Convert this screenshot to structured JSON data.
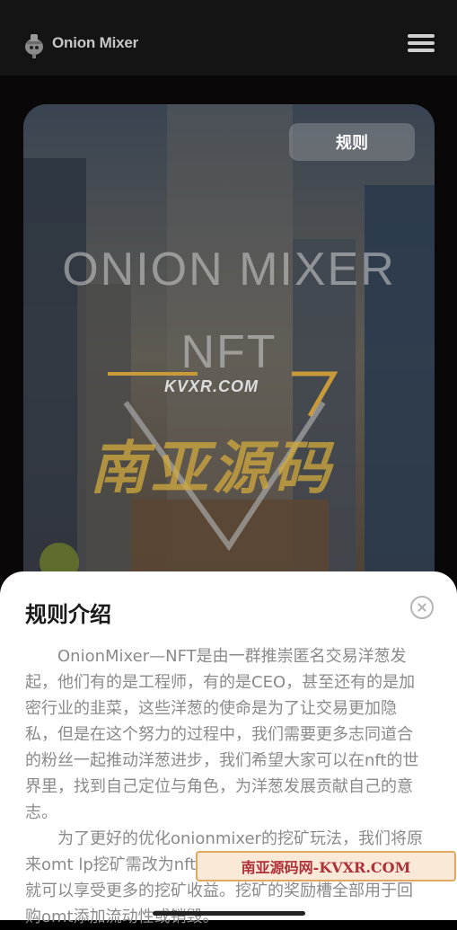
{
  "header": {
    "brand": "Onion Mixer",
    "logo_icon": "onion-logo-icon",
    "menu_icon": "hamburger-menu-icon"
  },
  "hero": {
    "rules_button": "规则",
    "title_line1": "ONION MIXER",
    "title_line2": "NFT",
    "watermark_small": "KVXR.COM",
    "watermark_big": "南亚源码"
  },
  "sheet": {
    "title": "规则介绍",
    "close_icon": "close-circle-icon",
    "paragraph1": "OnionMixer—NFT是由一群推崇匿名交易洋葱发起，他们有的是工程师，有的是CEO，甚至还有的是加密行业的韭菜，这些洋葱的使命是为了让交易更加隐私，但是在这个努力的过程中，我们需要更多志同道合的粉丝一起推动洋葱进步，我们希望大家可以在nft的世界里，找到自己定位与角色，为洋葱发展贡献自己的意志。",
    "paragraph2": "为了更好的优化onionmixer的挖矿玩法，我们将原来omt lp挖矿需改为nft挖矿，持有洋葱不同类别的nft就可以享受更多的挖矿收益。挖矿的奖励槽全部用于回购omt添加流动性或销毁。"
  },
  "watermark_banner": "南亚源码网-KVXR.COM"
}
